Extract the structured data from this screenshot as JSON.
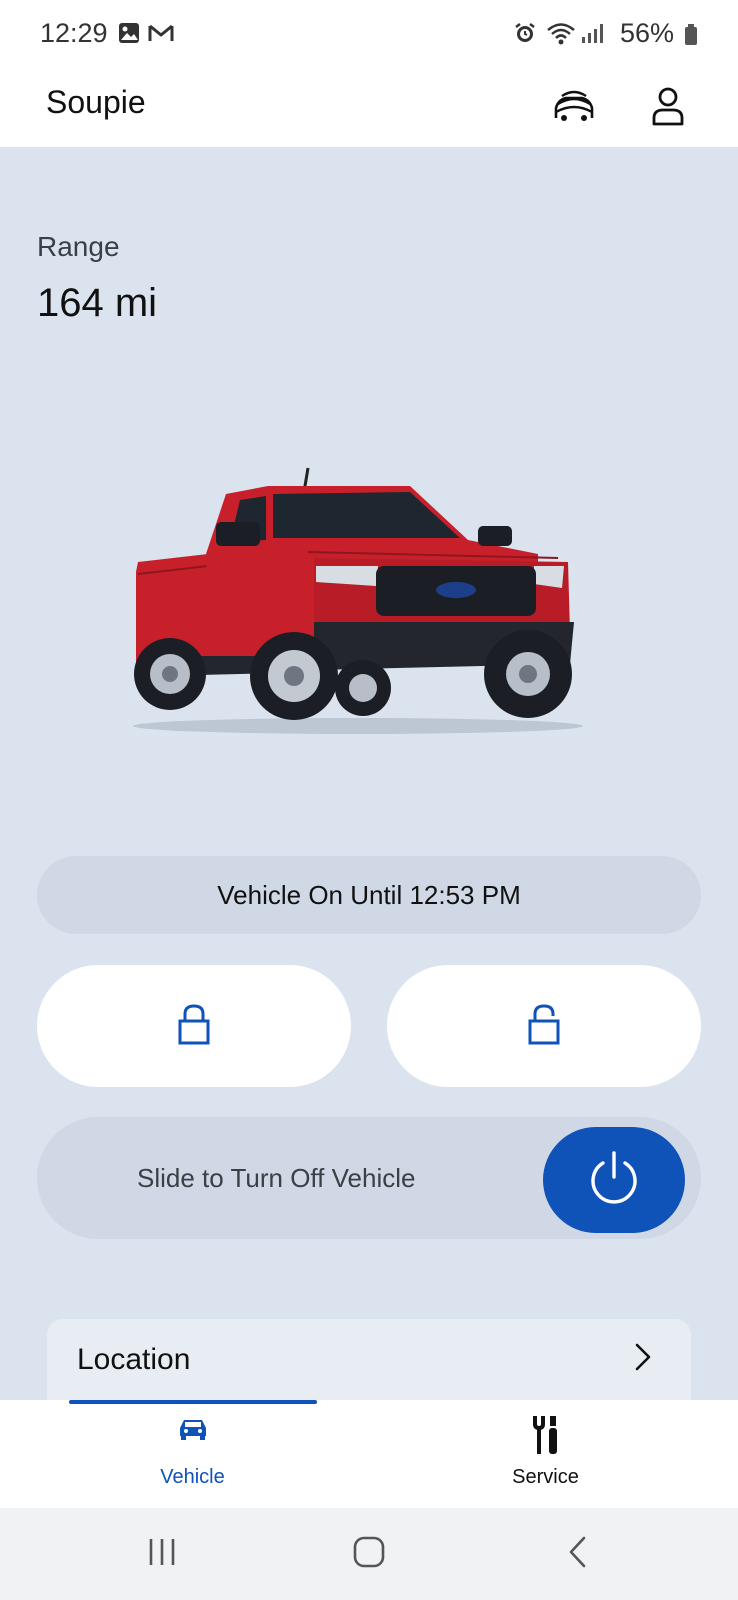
{
  "status_bar": {
    "time": "12:29",
    "battery_percent": "56%",
    "icons": [
      "gallery-icon",
      "gmail-icon",
      "alarm-icon",
      "wifi-icon",
      "signal-icon",
      "battery-icon"
    ]
  },
  "header": {
    "title": "Soupie",
    "icons": [
      "vehicles-icon",
      "account-icon"
    ]
  },
  "range": {
    "label": "Range",
    "value": "164 mi"
  },
  "vehicle": {
    "color": "#c8202b",
    "image_icon": "pickup-truck-image"
  },
  "status": {
    "text": "Vehicle On Until 12:53 PM"
  },
  "controls": {
    "lock_icon": "lock-icon",
    "unlock_icon": "unlock-icon",
    "slider_label": "Slide to Turn Off Vehicle",
    "power_icon": "power-icon"
  },
  "location_card": {
    "title": "Location"
  },
  "bottom_nav": {
    "items": [
      {
        "label": "Vehicle",
        "icon": "car-icon",
        "active": true
      },
      {
        "label": "Service",
        "icon": "tools-icon",
        "active": false
      }
    ]
  },
  "colors": {
    "accent": "#0f52b8",
    "background": "#dbe3ee",
    "pill": "#cfd8e4"
  }
}
